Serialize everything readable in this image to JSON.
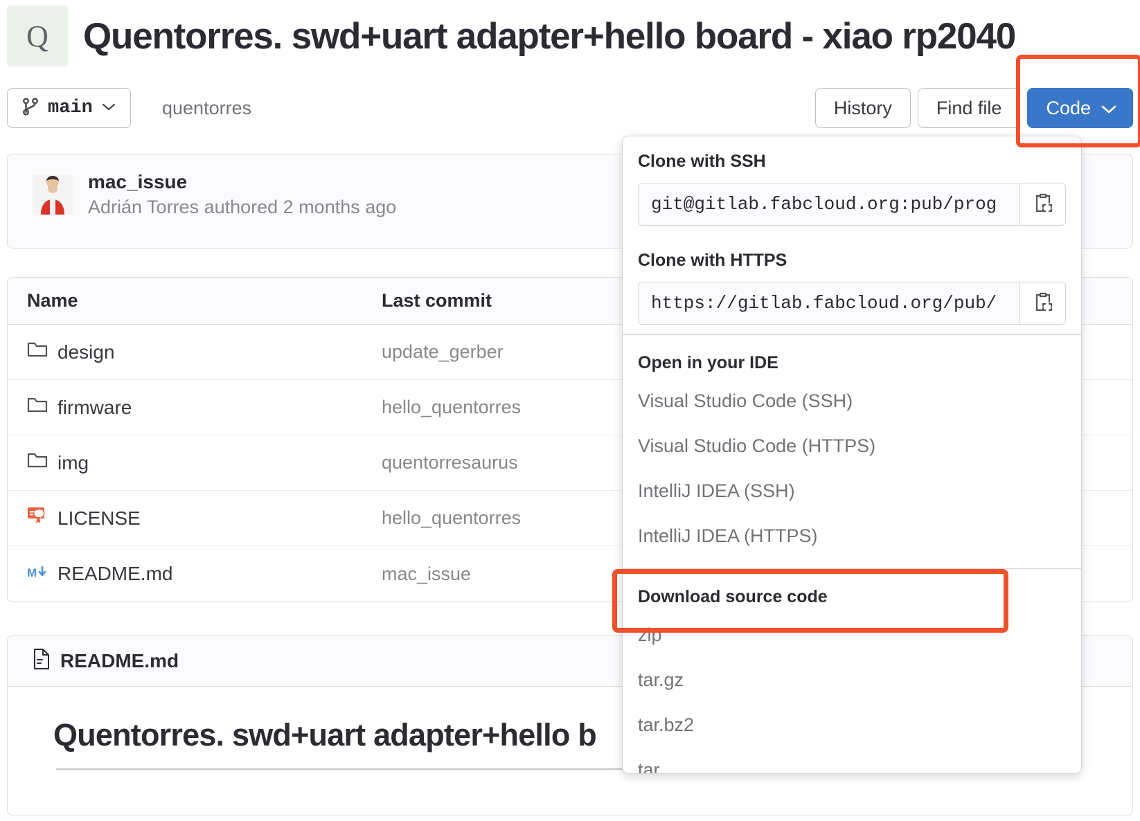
{
  "header": {
    "avatar_letter": "Q",
    "title": "Quentorres. swd+uart adapter+hello board - xiao rp2040"
  },
  "toolbar": {
    "branch": "main",
    "breadcrumb": "quentorres",
    "history_label": "History",
    "find_file_label": "Find file",
    "code_label": "Code"
  },
  "commit": {
    "message": "mac_issue",
    "meta": "Adrián Torres authored 2 months ago"
  },
  "files": {
    "col_name": "Name",
    "col_last_commit": "Last commit",
    "rows": [
      {
        "name": "design",
        "icon": "folder-icon",
        "last_commit": "update_gerber"
      },
      {
        "name": "firmware",
        "icon": "folder-icon",
        "last_commit": "hello_quentorres"
      },
      {
        "name": "img",
        "icon": "folder-icon",
        "last_commit": "quentorresaurus"
      },
      {
        "name": "LICENSE",
        "icon": "license-icon",
        "last_commit": "hello_quentorres"
      },
      {
        "name": "README.md",
        "icon": "markdown-icon",
        "last_commit": "mac_issue"
      }
    ]
  },
  "readme": {
    "file_label": "README.md",
    "heading": "Quentorres. swd+uart adapter+hello b"
  },
  "dropdown": {
    "ssh_label": "Clone with SSH",
    "ssh_value": "git@gitlab.fabcloud.org:pub/prog",
    "https_label": "Clone with HTTPS",
    "https_value": "https://gitlab.fabcloud.org/pub/",
    "ide_label": "Open in your IDE",
    "ide_items": [
      "Visual Studio Code (SSH)",
      "Visual Studio Code (HTTPS)",
      "IntelliJ IDEA (SSH)",
      "IntelliJ IDEA (HTTPS)"
    ],
    "download_label": "Download source code",
    "download_items": [
      "zip",
      "tar.gz",
      "tar.bz2",
      "tar"
    ]
  },
  "colors": {
    "accent_blue": "#3a77c8",
    "highlight_red": "#f0502a",
    "license_orange": "#e8603c",
    "markdown_blue": "#4a90d9"
  }
}
